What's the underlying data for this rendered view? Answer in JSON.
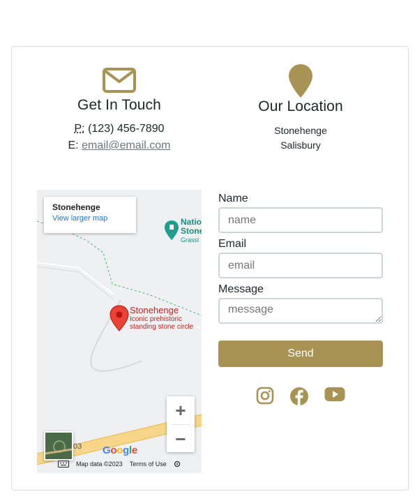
{
  "colors": {
    "accent": "#a89354",
    "link": "#6c757d",
    "border": "#dcdcdc"
  },
  "contact": {
    "title": "Get In Touch",
    "phone_label": "P:",
    "phone": "(123) 456-7890",
    "email_label": "E:",
    "email": "email@email.com",
    "icon": "envelope-icon"
  },
  "location": {
    "title": "Our Location",
    "line1": "Stonehenge",
    "line2": "Salisbury",
    "icon": "map-pin-icon"
  },
  "map": {
    "card_title": "Stonehenge",
    "card_link": "View larger map",
    "place_name": "Stonehenge",
    "place_desc_1": "Iconic prehistoric",
    "place_desc_2": "standing stone circle",
    "park_1": "Natio",
    "park_2": "Stone",
    "park_3": "Grassl",
    "road": "03",
    "zoom_in": "+",
    "zoom_out": "−",
    "google": "Google",
    "map_data": "Map data ©2023",
    "terms": "Terms of Use"
  },
  "form": {
    "name_label": "Name",
    "name_placeholder": "name",
    "email_label": "Email",
    "email_placeholder": "email",
    "message_label": "Message",
    "message_placeholder": "message",
    "send_label": "Send"
  },
  "socials": [
    "instagram-icon",
    "facebook-icon",
    "youtube-icon"
  ]
}
